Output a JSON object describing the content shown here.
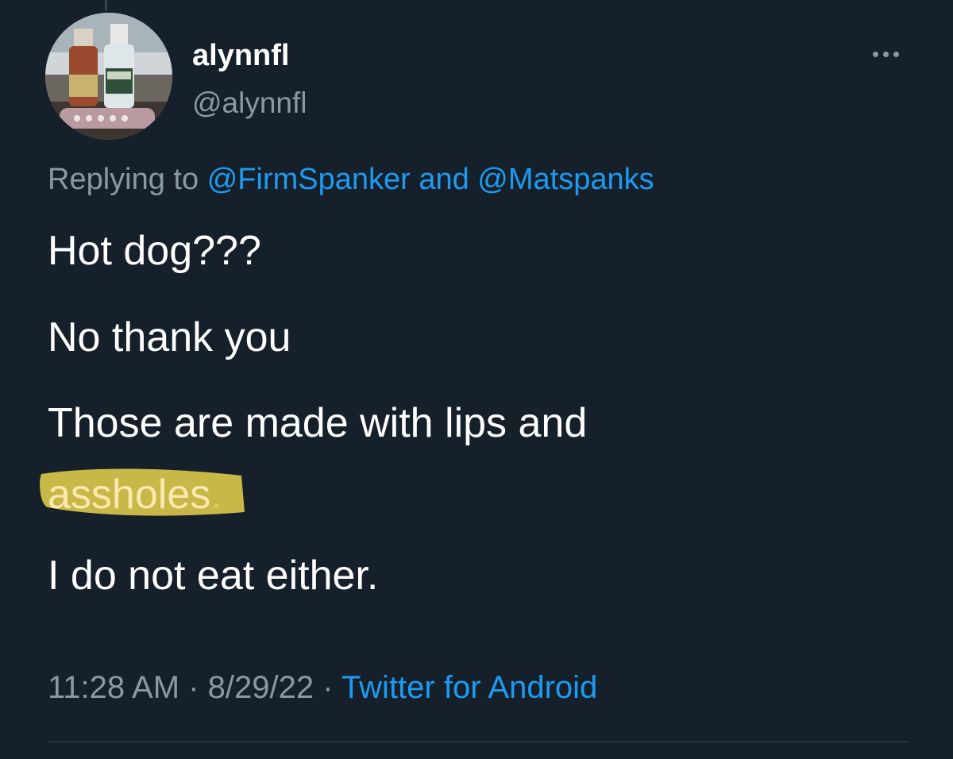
{
  "tweet": {
    "display_name": "alynnfl",
    "handle": "@alynnfl",
    "more_icon": "more-horizontal-icon",
    "replying_prefix": "Replying to",
    "replying_mention_1": "@FirmSpanker",
    "replying_and": "and",
    "replying_mention_2": "@Matspanks",
    "line_1": "Hot dog???",
    "line_2": "No thank you",
    "line_3": "Those are made with lips and",
    "line_4_highlighted": "assholes",
    "line_4_punct": ".",
    "line_5": "I do not eat either.",
    "time": "11:28 AM",
    "separator": "·",
    "date": "8/29/22",
    "source": "Twitter for Android"
  },
  "colors": {
    "background": "#15202b",
    "text": "#ffffff",
    "secondary": "#8b98a5",
    "link": "#1d9bf0",
    "highlighter": "#d8c64a"
  }
}
